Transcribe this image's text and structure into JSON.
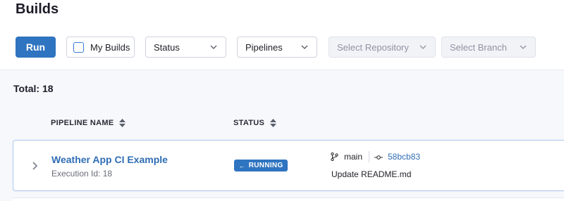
{
  "page": {
    "title": "Builds"
  },
  "toolbar": {
    "run_label": "Run",
    "my_builds_label": "My Builds",
    "status_select": "Status",
    "pipelines_select": "Pipelines",
    "repository_select": "Select Repository",
    "branch_select": "Select Branch"
  },
  "summary": {
    "total": "Total: 18"
  },
  "table": {
    "columns": [
      "PIPELINE NAME",
      "STATUS"
    ],
    "rows": [
      {
        "pipeline_name": "Weather App CI Example",
        "execution_id": "Execution Id: 18",
        "status": "RUNNING",
        "branch": "main",
        "commit": "58bcb83",
        "message": "Update README.md"
      }
    ]
  },
  "colors": {
    "accent": "#2f74c0",
    "link": "#2f6db5"
  }
}
